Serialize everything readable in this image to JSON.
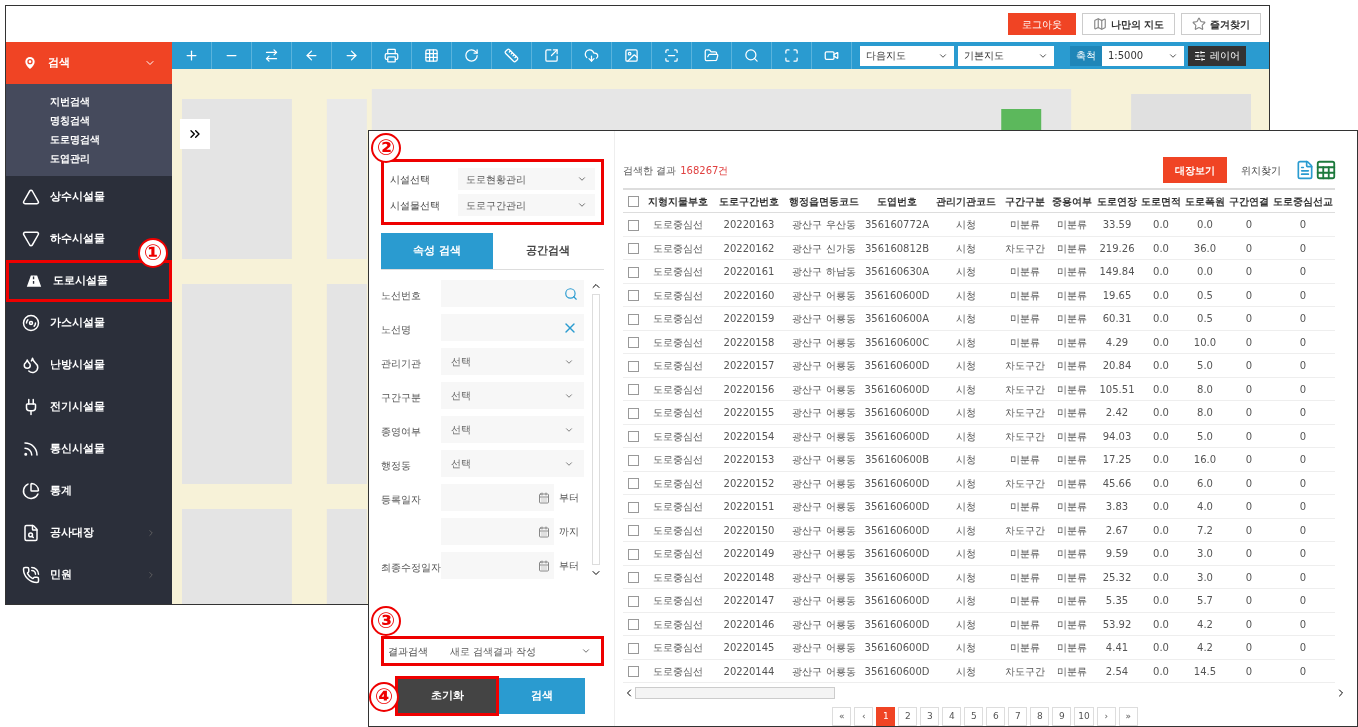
{
  "top_bar": {
    "logout": "로그아웃",
    "my_map": "나만의 지도",
    "favorites": "즐겨찾기"
  },
  "toolbar": {
    "map_type": "다음지도",
    "base_map": "기본지도",
    "scale_label": "축척",
    "scale": "1:5000",
    "layer_button": "레이어"
  },
  "search_menu": {
    "label": "검색",
    "expanded": true,
    "items": [
      "지번검색",
      "명칭검색",
      "도로명검색",
      "도엽관리"
    ]
  },
  "menu": [
    {
      "label": "상수시설물",
      "has_submenu": false,
      "highlighted": false
    },
    {
      "label": "하수시설물",
      "has_submenu": false,
      "highlighted": false
    },
    {
      "label": "도로시설물",
      "has_submenu": false,
      "highlighted": true,
      "annotation": "①"
    },
    {
      "label": "가스시설물",
      "has_submenu": false,
      "highlighted": false
    },
    {
      "label": "난방시설물",
      "has_submenu": false,
      "highlighted": false
    },
    {
      "label": "전기시설물",
      "has_submenu": false,
      "highlighted": false
    },
    {
      "label": "통신시설물",
      "has_submenu": false,
      "highlighted": false
    },
    {
      "label": "통계",
      "has_submenu": false,
      "highlighted": false
    },
    {
      "label": "공사대장",
      "has_submenu": true,
      "highlighted": false
    },
    {
      "label": "민원",
      "has_submenu": true,
      "highlighted": false
    }
  ],
  "filter": {
    "annotation": "②",
    "highlighted": true,
    "facility_selects": [
      {
        "label": "시설선택",
        "value": "도로현황관리"
      },
      {
        "label": "시설물선택",
        "value": "도로구간관리"
      }
    ],
    "tabs": [
      {
        "label": "속성 검색",
        "selected": true
      },
      {
        "label": "공간검색",
        "selected": false
      }
    ],
    "fields": [
      {
        "kind": "search",
        "label": "노선번호"
      },
      {
        "kind": "clear",
        "label": "노선명"
      },
      {
        "kind": "select",
        "label": "관리기관",
        "value": "선택"
      },
      {
        "kind": "select",
        "label": "구간구분",
        "value": "선택"
      },
      {
        "kind": "select",
        "label": "종영여부",
        "value": "선택"
      },
      {
        "kind": "select",
        "label": "행정동",
        "value": "선택"
      },
      {
        "kind": "date",
        "label": "등록일자",
        "suffix": "부터"
      },
      {
        "kind": "date",
        "suffix": "까지"
      },
      {
        "kind": "date",
        "label": "최종수정일자",
        "suffix": "부터"
      }
    ],
    "result_search": {
      "annotation": "③",
      "highlighted": true,
      "label": "결과검색",
      "value": "새로 검색결과 작성"
    },
    "reset_button": {
      "label": "초기화",
      "annotation": "④",
      "highlighted": true
    },
    "search_button": "검색"
  },
  "results": {
    "select_all_checked": false,
    "label": "검색한 결과",
    "count": "168267건",
    "ledger_button": "대장보기",
    "locate_button": "위치찾기",
    "columns": [
      "지형지물부호",
      "도로구간번호",
      "행정읍면동코드",
      "도엽번호",
      "관리기관코드",
      "구간구분",
      "중용여부",
      "도로연장",
      "도로면적",
      "도로폭원",
      "구간연결",
      "도로중심선교"
    ],
    "rows": [
      {
        "checked": false,
        "cells": [
          "도로중심선",
          "20220163",
          "광산구 우산동",
          "356160772A",
          "시청",
          "미분류",
          "미분류",
          "33.59",
          "0.0",
          "0.0",
          "0",
          "0"
        ]
      },
      {
        "checked": false,
        "cells": [
          "도로중심선",
          "20220162",
          "광산구 신가동",
          "356160812B",
          "시청",
          "차도구간",
          "미분류",
          "219.26",
          "0.0",
          "36.0",
          "0",
          "0"
        ]
      },
      {
        "checked": false,
        "cells": [
          "도로중심선",
          "20220161",
          "광산구 하남동",
          "356160630A",
          "시청",
          "미분류",
          "미분류",
          "149.84",
          "0.0",
          "0.0",
          "0",
          "0"
        ]
      },
      {
        "checked": false,
        "cells": [
          "도로중심선",
          "20220160",
          "광산구 어룡동",
          "356160600D",
          "시청",
          "미분류",
          "미분류",
          "19.65",
          "0.0",
          "0.5",
          "0",
          "0"
        ]
      },
      {
        "checked": false,
        "cells": [
          "도로중심선",
          "20220159",
          "광산구 어룡동",
          "356160600A",
          "시청",
          "미분류",
          "미분류",
          "60.31",
          "0.0",
          "0.5",
          "0",
          "0"
        ]
      },
      {
        "checked": false,
        "cells": [
          "도로중심선",
          "20220158",
          "광산구 어룡동",
          "356160600C",
          "시청",
          "미분류",
          "미분류",
          "4.29",
          "0.0",
          "10.0",
          "0",
          "0"
        ]
      },
      {
        "checked": false,
        "cells": [
          "도로중심선",
          "20220157",
          "광산구 어룡동",
          "356160600D",
          "시청",
          "차도구간",
          "미분류",
          "20.84",
          "0.0",
          "5.0",
          "0",
          "0"
        ]
      },
      {
        "checked": false,
        "cells": [
          "도로중심선",
          "20220156",
          "광산구 어룡동",
          "356160600D",
          "시청",
          "차도구간",
          "미분류",
          "105.51",
          "0.0",
          "8.0",
          "0",
          "0"
        ]
      },
      {
        "checked": false,
        "cells": [
          "도로중심선",
          "20220155",
          "광산구 어룡동",
          "356160600D",
          "시청",
          "차도구간",
          "미분류",
          "2.42",
          "0.0",
          "8.0",
          "0",
          "0"
        ]
      },
      {
        "checked": false,
        "cells": [
          "도로중심선",
          "20220154",
          "광산구 어룡동",
          "356160600D",
          "시청",
          "차도구간",
          "미분류",
          "94.03",
          "0.0",
          "5.0",
          "0",
          "0"
        ]
      },
      {
        "checked": false,
        "cells": [
          "도로중심선",
          "20220153",
          "광산구 어룡동",
          "356160600B",
          "시청",
          "미분류",
          "미분류",
          "17.25",
          "0.0",
          "16.0",
          "0",
          "0"
        ]
      },
      {
        "checked": false,
        "cells": [
          "도로중심선",
          "20220152",
          "광산구 어룡동",
          "356160600D",
          "시청",
          "차도구간",
          "미분류",
          "45.66",
          "0.0",
          "6.0",
          "0",
          "0"
        ]
      },
      {
        "checked": false,
        "cells": [
          "도로중심선",
          "20220151",
          "광산구 어룡동",
          "356160600D",
          "시청",
          "미분류",
          "미분류",
          "3.83",
          "0.0",
          "4.0",
          "0",
          "0"
        ]
      },
      {
        "checked": false,
        "cells": [
          "도로중심선",
          "20220150",
          "광산구 어룡동",
          "356160600D",
          "시청",
          "차도구간",
          "미분류",
          "2.67",
          "0.0",
          "7.2",
          "0",
          "0"
        ]
      },
      {
        "checked": false,
        "cells": [
          "도로중심선",
          "20220149",
          "광산구 어룡동",
          "356160600D",
          "시청",
          "미분류",
          "미분류",
          "9.59",
          "0.0",
          "3.0",
          "0",
          "0"
        ]
      },
      {
        "checked": false,
        "cells": [
          "도로중심선",
          "20220148",
          "광산구 어룡동",
          "356160600D",
          "시청",
          "미분류",
          "미분류",
          "25.32",
          "0.0",
          "3.0",
          "0",
          "0"
        ]
      },
      {
        "checked": false,
        "cells": [
          "도로중심선",
          "20220147",
          "광산구 어룡동",
          "356160600D",
          "시청",
          "미분류",
          "미분류",
          "5.35",
          "0.0",
          "5.7",
          "0",
          "0"
        ]
      },
      {
        "checked": false,
        "cells": [
          "도로중심선",
          "20220146",
          "광산구 어룡동",
          "356160600D",
          "시청",
          "미분류",
          "미분류",
          "53.92",
          "0.0",
          "4.2",
          "0",
          "0"
        ]
      },
      {
        "checked": false,
        "cells": [
          "도로중심선",
          "20220145",
          "광산구 어룡동",
          "356160600D",
          "시청",
          "미분류",
          "미분류",
          "4.41",
          "0.0",
          "4.2",
          "0",
          "0"
        ]
      },
      {
        "checked": false,
        "cells": [
          "도로중심선",
          "20220144",
          "광산구 어룡동",
          "356160600D",
          "시청",
          "차도구간",
          "미분류",
          "2.54",
          "0.0",
          "14.5",
          "0",
          "0"
        ]
      }
    ],
    "pages": [
      {
        "label": "«",
        "selected": false
      },
      {
        "label": "‹",
        "selected": false
      },
      {
        "label": "1",
        "selected": true
      },
      {
        "label": "2",
        "selected": false
      },
      {
        "label": "3",
        "selected": false
      },
      {
        "label": "4",
        "selected": false
      },
      {
        "label": "5",
        "selected": false
      },
      {
        "label": "6",
        "selected": false
      },
      {
        "label": "7",
        "selected": false
      },
      {
        "label": "8",
        "selected": false
      },
      {
        "label": "9",
        "selected": false
      },
      {
        "label": "10",
        "selected": false
      },
      {
        "label": "›",
        "selected": false
      },
      {
        "label": "»",
        "selected": false
      }
    ]
  }
}
